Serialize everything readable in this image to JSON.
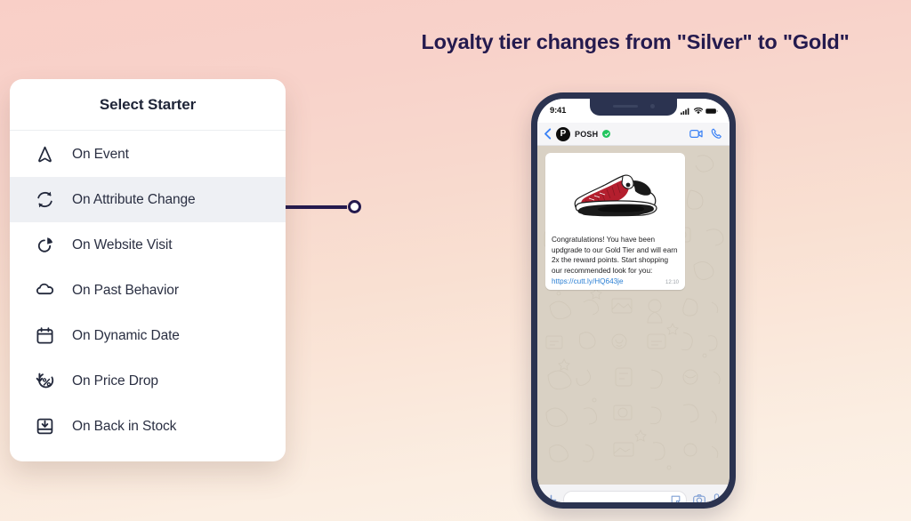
{
  "panel": {
    "title": "Loyalty tier changes from \"Silver\" to \"Gold\"",
    "background_from": "#fbe6e0",
    "background_to": "#fffdf4"
  },
  "page": {
    "background_from": "#f9cfc7",
    "background_to": "#fcf2e8",
    "accent_navy": "#241a4e"
  },
  "starter_card": {
    "title": "Select Starter",
    "items": [
      {
        "label": "On Event",
        "icon": "navigation-arrow-icon",
        "selected": false
      },
      {
        "label": "On Attribute Change",
        "icon": "refresh-cycle-icon",
        "selected": true
      },
      {
        "label": "On Website Visit",
        "icon": "pie-chart-icon",
        "selected": false
      },
      {
        "label": "On Past Behavior",
        "icon": "cloud-icon",
        "selected": false
      },
      {
        "label": "On Dynamic Date",
        "icon": "calendar-icon",
        "selected": false
      },
      {
        "label": "On Price Drop",
        "icon": "price-drop-icon",
        "selected": false
      },
      {
        "label": "On Back in Stock",
        "icon": "back-in-stock-icon",
        "selected": false
      }
    ],
    "selected_highlight": "#eef0f4"
  },
  "phone": {
    "status_bar": {
      "time": "9:41",
      "icons": [
        "cellular-signal-icon",
        "wifi-icon",
        "battery-icon"
      ]
    },
    "chat_header": {
      "back_icon": "chevron-left-icon",
      "avatar_initial": "P",
      "contact_name": "POSH",
      "verified": true,
      "verified_color": "#22c55e",
      "actions": [
        "video-call-icon",
        "phone-call-icon"
      ]
    },
    "message": {
      "image_alt": "red-white-sneaker-photo",
      "text": "Congratulations! You have been updgrade to our Gold Tier and will earn 2x the reward points. Start shopping our recommended look for you: ",
      "link": "https://cutt.ly/HQ643je",
      "link_color": "#2a7fd4",
      "time": "12:10",
      "bubble_color": "#ffffff"
    },
    "input_bar": {
      "placeholder": "",
      "value": "",
      "left_icon": "plus-icon",
      "right_icons": [
        "sticker-icon",
        "camera-icon",
        "microphone-icon"
      ],
      "icon_color": "#7f9fd4"
    },
    "wallpaper_color": "#d9d1c4",
    "frame_color": "#2b3350"
  }
}
